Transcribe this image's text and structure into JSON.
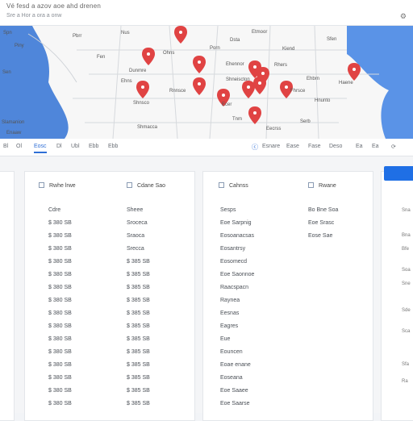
{
  "app": {
    "title": "Vé fesd a azov aoe ahd drenen",
    "subtitle": "Sre a Hor a ora a onw"
  },
  "map": {
    "labels": [
      "Spn",
      "Pbrr",
      "Nus",
      "Dsta",
      "Etmoor",
      "Piny",
      "Ohns",
      "Porn",
      "Kiend",
      "Sfen",
      "Fen",
      "Dunmre",
      "Ehennor",
      "Rhers",
      "Sen",
      "Ehns",
      "Ehbrn",
      "Haene",
      "Shneiscton",
      "Rnnsce",
      "Fhrsce",
      "Shnsco",
      "Ecer",
      "Hnunto",
      "Slamanion",
      "Tnm",
      "Serb",
      "Shmacca",
      "Eecrss",
      "Enaaw"
    ]
  },
  "toolbar": {
    "left": [
      "Bl",
      "Ol",
      "Eosc",
      "Dl",
      "Ubl",
      "Ebb"
    ],
    "right": [
      "Esnare",
      "Ease",
      "Fase",
      "Deso",
      "Ea",
      "Ea"
    ]
  },
  "list": {
    "headers": [
      "Rwhe lrwe",
      "Cdane Sao",
      "Cahnss",
      "Rwane"
    ],
    "col1": [
      "Cdre",
      "$ 380 SB",
      "$ 380 SB",
      "$ 380 SB",
      "$ 380 SB",
      "$ 380 SB",
      "$ 380 SB",
      "$ 380 SB",
      "$ 380 SB",
      "$ 380 SB",
      "$ 380 SB",
      "$ 380 SB",
      "$ 380 SB",
      "$ 380 SB",
      "$ 380 SB",
      "$ 380 SB"
    ],
    "col2": [
      "Sheee",
      "Sroceca",
      "Sraoca",
      "Srecca",
      "$ 385 SB",
      "$ 385 SB",
      "$ 385 SB",
      "$ 385 SB",
      "$ 385 SB",
      "$ 385 SB",
      "$ 385 SB",
      "$ 385 SB",
      "$ 385 SB",
      "$ 385 SB",
      "$ 385 SB",
      "$ 385 SB"
    ],
    "col3": [
      "Sesps",
      "Eoe Sarpnig",
      "Eosoanacsas",
      "Eosantrsy",
      "Eosomecd",
      "Eoe Saonnoe",
      "Raacspacn",
      "Raynea",
      "Eesnas",
      "Eagres",
      "Eue",
      "Eouncen",
      "Eoae enane",
      "Eoseana",
      "Eoe Saaee",
      "Eoe Saarse"
    ],
    "col4": [
      "Bo Bne Soa",
      "Eoe Srasc",
      "Eose Sae"
    ]
  },
  "right_panel": {
    "labels": [
      "Sna",
      "Bna",
      "Bfe",
      "Soa",
      "Sne",
      "Sde",
      "Sca",
      "Sfa",
      "Ra"
    ]
  }
}
